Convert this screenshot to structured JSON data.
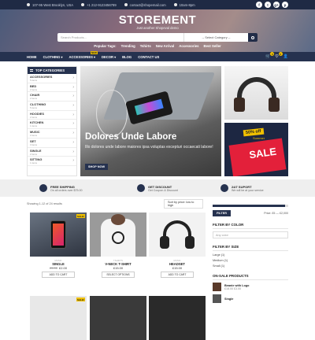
{
  "topbar": {
    "address": "107-95 West Brooklyn, USA",
    "phone": "+1 212-9123456789",
    "email": "contact@shopemail.com",
    "hours": "10am-8pm",
    "social": [
      "f",
      "t",
      "g+",
      "p"
    ]
  },
  "header": {
    "logo": "STOREMENT",
    "tagline": "Just another Shopeval demo",
    "search_placeholder": "Search Products...",
    "category_select": "-- Select Category --",
    "popular_label": "Popular Tags:",
    "popular_tags": [
      "Trending",
      "Tshirts",
      "New Arrival",
      "Accessories",
      "Best Seller"
    ]
  },
  "nav": {
    "items": [
      {
        "label": "HOME"
      },
      {
        "label": "CLOTHING"
      },
      {
        "label": "ACCESSORIES",
        "badge": "NEW"
      },
      {
        "label": "DECOR"
      },
      {
        "label": "BLOG"
      },
      {
        "label": "CONTACT US"
      }
    ],
    "cart_count": "0",
    "wishlist_count": "0"
  },
  "sidebar": {
    "title": "TOP CATEGORIES",
    "items": [
      {
        "name": "ACCESSORIES",
        "count": "5 items"
      },
      {
        "name": "BED",
        "count": "2 items"
      },
      {
        "name": "CHAIR",
        "count": "2 items"
      },
      {
        "name": "CLOTHING",
        "count": "5 items"
      },
      {
        "name": "HOODIES",
        "count": "2 items"
      },
      {
        "name": "KITCHEN",
        "count": "1 items"
      },
      {
        "name": "MUSIC",
        "count": "2 items"
      },
      {
        "name": "SET",
        "count": "3 items"
      },
      {
        "name": "SINGLE",
        "count": "2 items"
      },
      {
        "name": "SITTING",
        "count": "1 items"
      }
    ]
  },
  "slider": {
    "title": "Dolores Unde Labore",
    "text": "Illo dolores unde labore maiores ipsa voluptas excepturi occaecati labore!",
    "button": "SHOP NOW"
  },
  "promo": {
    "discount": "50% off",
    "season": "Summer",
    "sale": "SALE"
  },
  "features": [
    {
      "title": "FREE SHIPPING",
      "sub": "On all orders over $75.00"
    },
    {
      "title": "GET DISCOUNT",
      "sub": "Get Coupon & Discount"
    },
    {
      "title": "24/7 SUPORT",
      "sub": "We will be at your service"
    }
  ],
  "shop": {
    "results": "Showing 1-12 of 24 results",
    "sort": "Sort by price: low to high"
  },
  "products": [
    {
      "category": "MUSIC",
      "name": "SINGLE",
      "old_price": "£5.00",
      "price": "£2.00",
      "button": "ADD TO CART",
      "sale": "SALE!"
    },
    {
      "category": "TSHIRTS",
      "name": "V-NECK T-SHIRT",
      "old_price": "",
      "price": "£15.00",
      "button": "SELECT OPTIONS",
      "sale": ""
    },
    {
      "category": "MUSIC",
      "name": "HEADSET",
      "old_price": "",
      "price": "£15.00",
      "button": "ADD TO CART",
      "sale": ""
    }
  ],
  "second_row_sale": "SALE!",
  "filters": {
    "button": "FILTER",
    "price_range": "Price: £5 — £2,000",
    "color_title": "FILTER BY COLOR",
    "color_select": "Any color",
    "size_title": "FILTER BY SIZE",
    "sizes": [
      "Large (1)",
      "Medium (1)",
      "Small (1)"
    ],
    "onsale_title": "ON-SALE PRODUCTS",
    "onsale": [
      {
        "name": "Beanie with Logo",
        "price": "£18.00 £3.00"
      },
      {
        "name": "Single",
        "price": ""
      }
    ]
  }
}
